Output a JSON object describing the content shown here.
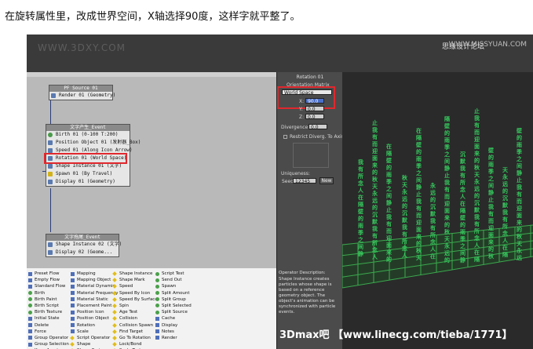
{
  "caption": "在旋转属性里，改成世界空间，X轴选择90度，这样字就平整了。",
  "watermark_left": "WWW.3DXY.COM",
  "watermark_right_cn": "思缘设计论坛",
  "watermark_right_url": "WWW.MISSYUAN.COM",
  "nodes": {
    "pf_source": {
      "title": "PF Source 01",
      "ops": [
        "Render 01 (Geometry)"
      ]
    },
    "event1": {
      "title": "文字产生_Event",
      "ops": [
        "Birth 01 (0-100 T:200)",
        "Position Object 01 (发射器_Box)",
        "Speed 01 (Along Icon Arrow)",
        "Rotation 01 (World Space)",
        "Shape Instance 01 (文字)",
        "Spawn 01 (By Travel)",
        "Display 01 (Geometry)"
      ]
    },
    "event2": {
      "title": "文字拖尾_Event",
      "ops": [
        "Shape Instance 02 (文字)",
        "Display 02 (Geome..."
      ]
    }
  },
  "rotation_panel": {
    "title": "Rotation 01",
    "orientation_label": "Orientation Matrix",
    "orientation_value": "World Space",
    "x_label": "X:",
    "x_value": "90.0",
    "y_label": "Y:",
    "y_value": "0.0",
    "z_label": "Z:",
    "z_value": "0.0",
    "divergence_label": "Divergence:",
    "divergence_value": "0.0",
    "restrict_label": "Restrict Diverg. To Axis",
    "uniqueness_label": "Uniqueness:",
    "seed_label": "Seed:",
    "seed_value": "12345",
    "new_label": "New"
  },
  "description": {
    "title": "Operator Description:",
    "text": "Shape Instance creates particles whose shape is based on a reference geometry object. The object's animation can be synchronized with particle events."
  },
  "depot": {
    "col1": [
      "Preset Flow",
      "Empty Flow",
      "Standard Flow",
      "Birth",
      "Birth Paint",
      "Birth Script",
      "Birth Texture",
      "Initial State",
      "Delete",
      "Force",
      "Group Operator",
      "Group Selection",
      "Keep Apart"
    ],
    "col2": [
      "Mapping",
      "Mapping Object",
      "Material Dynamic",
      "Material Frequency",
      "Material Static",
      "Placement Paint",
      "Position Icon",
      "Position Object",
      "Rotation",
      "Scale",
      "Script Operator",
      "Shape",
      "Shape Facing"
    ],
    "col3": [
      "Shape Instance",
      "Shape Mark",
      "Speed",
      "Speed By Icon",
      "Speed By Surface",
      "Spin",
      "Age Test",
      "Collision",
      "Collision Spawn",
      "Find Target",
      "Go To Rotation",
      "Lock/Bond",
      "Scale Test"
    ],
    "col4": [
      "Script Test",
      "Send Out",
      "Spawn",
      "Split Amount",
      "Split Group",
      "Split Selected",
      "Split Source",
      "Cache",
      "Display",
      "Notes",
      "Render"
    ]
  },
  "viewport_glyphs": [
    "我",
    "有",
    "所",
    "念",
    "人",
    "在",
    "隔",
    "壁",
    "的",
    "雨",
    "季",
    "之",
    "间",
    "静",
    "止",
    "我",
    "有",
    "而",
    "迎",
    "面",
    "来",
    "的",
    "秋",
    "天",
    "永",
    "远",
    "的",
    "沉",
    "默"
  ],
  "footer": "3Dmax吧 【www.linecg.com/tieba/1771】"
}
